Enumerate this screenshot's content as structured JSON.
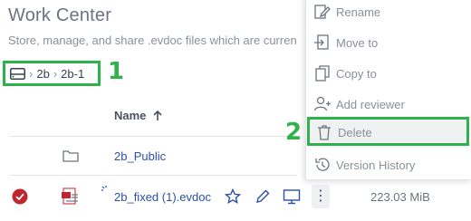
{
  "header": {
    "title": "Work Center",
    "subtitle": "Store, manage, and share .evdoc files which are curren"
  },
  "breadcrumb": {
    "items": [
      "2b",
      "2b-1"
    ]
  },
  "annotations": {
    "callout_1": "1",
    "callout_2": "2",
    "highlight_color": "#2db34a"
  },
  "table": {
    "column_name": "Name",
    "sort_icon": "arrow-up-icon",
    "rows": [
      {
        "name": "2b_Public",
        "type": "folder"
      },
      {
        "name": "2b_fixed (1).evdoc",
        "type": "evdoc",
        "size": "223.03 MiB",
        "selected": true
      }
    ]
  },
  "context_menu": {
    "items": [
      {
        "label": "Rename",
        "icon": "rename-icon"
      },
      {
        "label": "Move to",
        "icon": "move-to-icon"
      },
      {
        "label": "Copy to",
        "icon": "copy-icon"
      },
      {
        "label": "Add reviewer",
        "icon": "add-reviewer-icon"
      },
      {
        "label": "Delete",
        "icon": "trash-icon"
      },
      {
        "label": "Version History",
        "icon": "history-icon"
      }
    ]
  },
  "colors": {
    "link": "#2a4fa8",
    "check": "#c0262d",
    "muted": "#8a9099"
  }
}
